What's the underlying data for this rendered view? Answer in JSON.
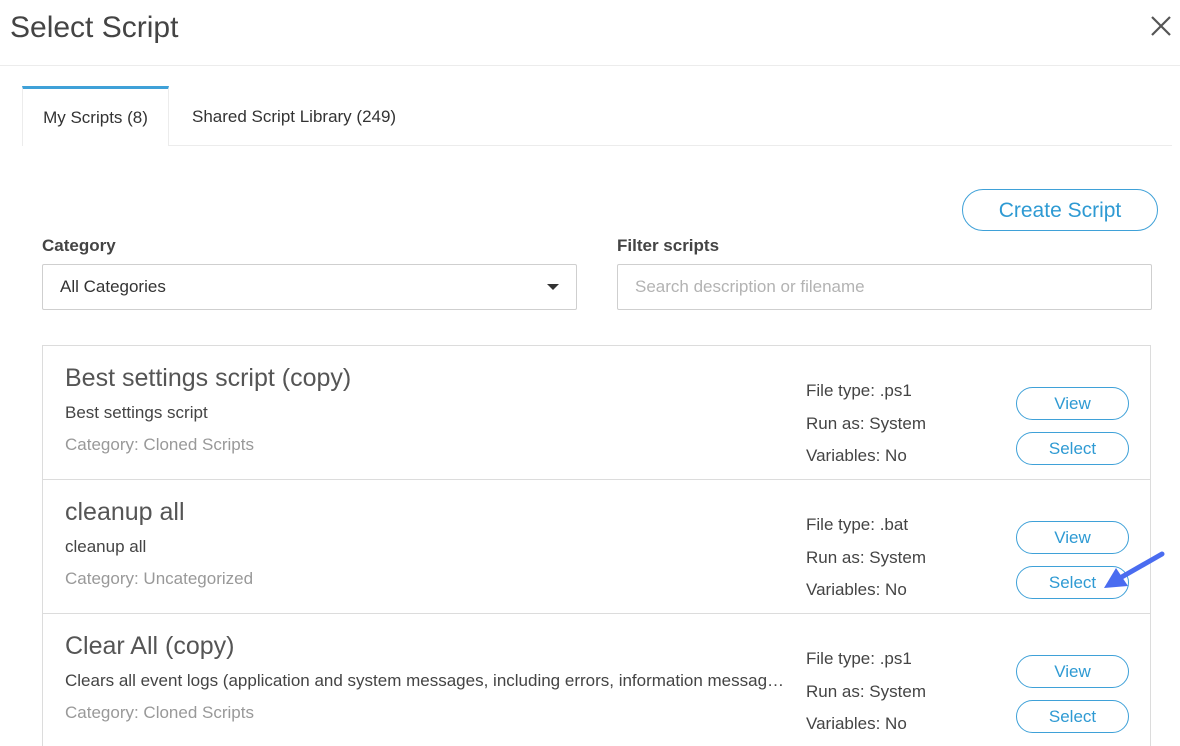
{
  "dialog": {
    "title": "Select Script",
    "close_icon": "close-icon"
  },
  "tabs": [
    {
      "label": "My Scripts (8)",
      "active": true
    },
    {
      "label": "Shared Script Library (249)",
      "active": false
    }
  ],
  "toolbar": {
    "create_label": "Create Script"
  },
  "filters": {
    "category_label": "Category",
    "category_value": "All Categories",
    "filter_label": "Filter scripts",
    "search_placeholder": "Search description or filename",
    "search_value": ""
  },
  "scripts": [
    {
      "title": "Best settings script (copy)",
      "description": "Best settings script",
      "category": "Category: Cloned Scripts",
      "file_type": "File type: .ps1",
      "run_as": "Run as: System",
      "variables": "Variables: No",
      "view_label": "View",
      "select_label": "Select"
    },
    {
      "title": "cleanup all",
      "description": "cleanup all",
      "category": "Category: Uncategorized",
      "file_type": "File type: .bat",
      "run_as": "Run as: System",
      "variables": "Variables: No",
      "view_label": "View",
      "select_label": "Select"
    },
    {
      "title": "Clear All (copy)",
      "description": "Clears all event logs (application and system messages, including errors, information messages, and warnings)",
      "category": "Category: Cloned Scripts",
      "file_type": "File type: .ps1",
      "run_as": "Run as: System",
      "variables": "Variables: No",
      "view_label": "View",
      "select_label": "Select"
    }
  ],
  "annotation": {
    "arrow_icon": "pointer-arrow-icon",
    "arrow_color": "#4a6cf0"
  },
  "colors": {
    "accent": "#2e9ad3",
    "border": "#dcdcdc"
  }
}
